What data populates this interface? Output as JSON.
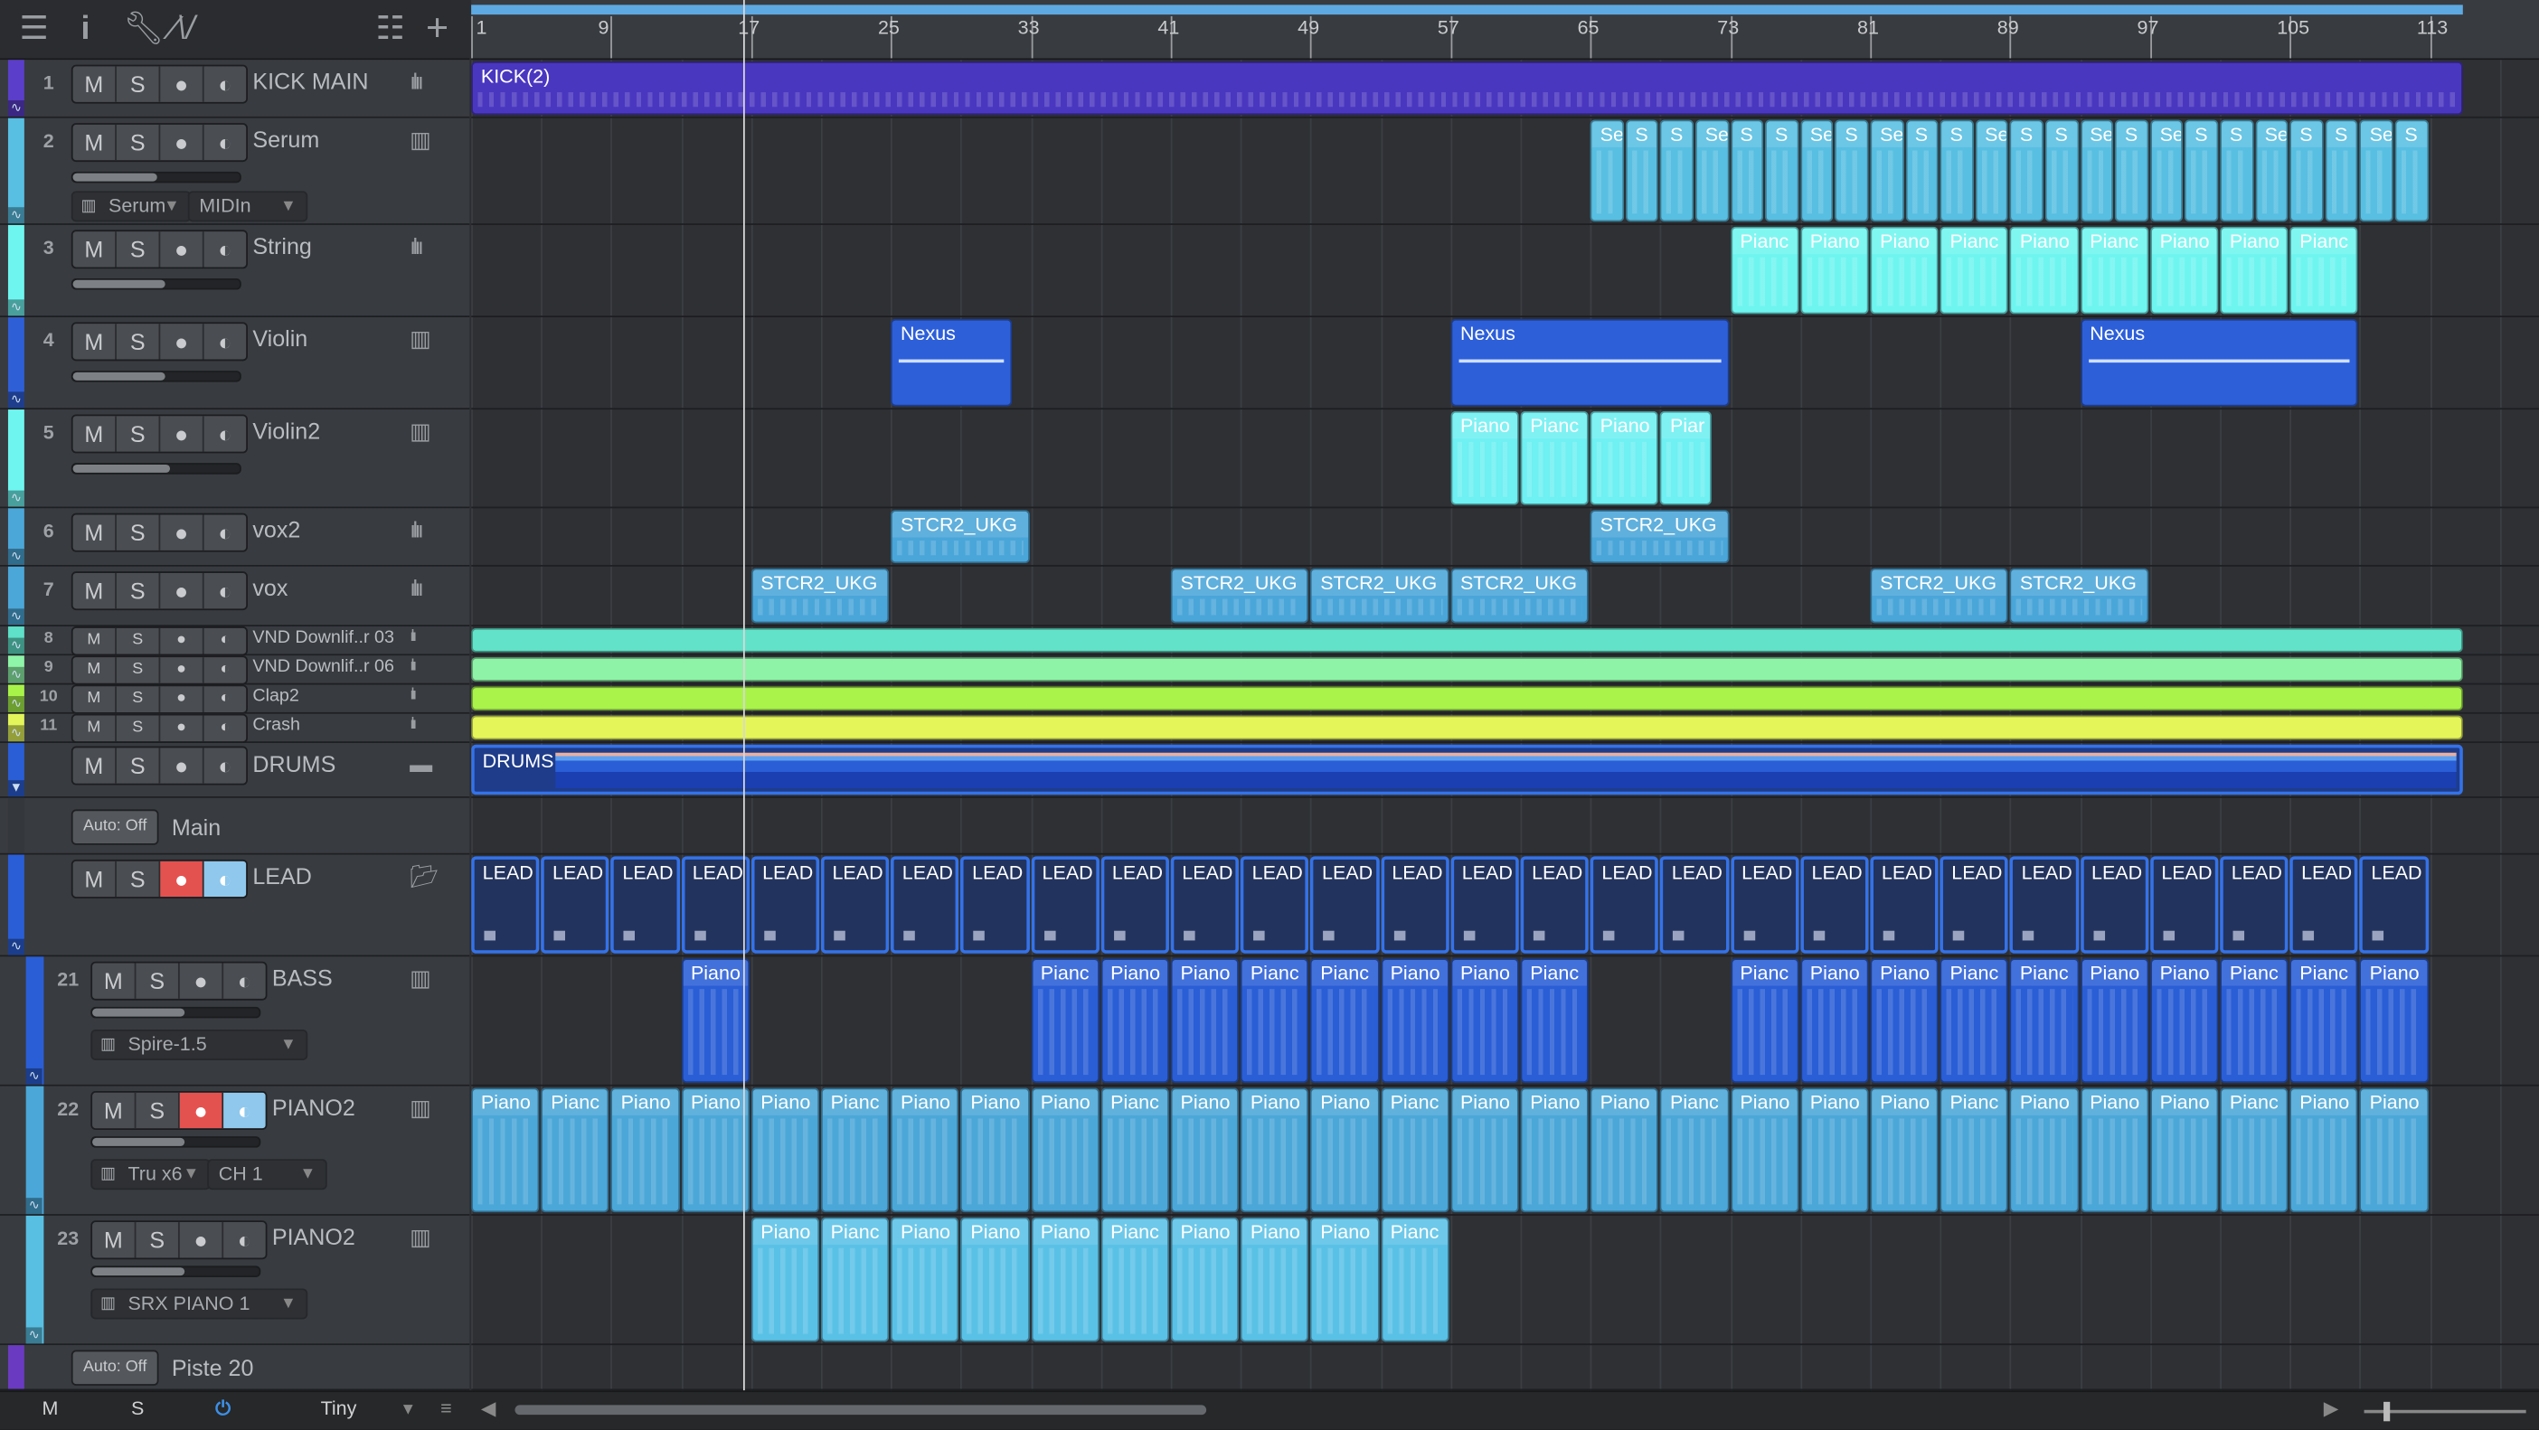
{
  "toolbar": {
    "icons": [
      "menu-icon",
      "info-icon",
      "wrench-icon",
      "automation-icon",
      "track-list-icon",
      "add-track-icon"
    ]
  },
  "ruler": {
    "bars": [
      "1",
      "9",
      "17",
      "25",
      "33",
      "41",
      "49",
      "57",
      "65",
      "73",
      "81",
      "89",
      "97",
      "105",
      "113"
    ]
  },
  "tracks": [
    {
      "num": "1",
      "name": "KICK MAIN",
      "color": "#5b3ec9",
      "type": "audio",
      "h": 36,
      "icon": "waveform",
      "clips": [
        {
          "s": 1,
          "l": 114,
          "t": "KICK(2)",
          "c": "#4a37c0"
        }
      ]
    },
    {
      "num": "2",
      "name": "Serum",
      "color": "#58bfe2",
      "type": "inst",
      "h": 66,
      "icon": "piano",
      "fader": 0.5,
      "sel": [
        "Serum",
        "MIDIn"
      ],
      "clips": "serum"
    },
    {
      "num": "3",
      "name": "String",
      "color": "#6ff5f0",
      "type": "audio2",
      "h": 57,
      "icon": "waveform",
      "fader": 0.55,
      "clips": "string"
    },
    {
      "num": "4",
      "name": "Violin",
      "color": "#2f5fd7",
      "type": "audio2",
      "h": 57,
      "icon": "piano",
      "fader": 0.55,
      "clips": [
        {
          "s": 25,
          "l": 7,
          "t": "Nexus",
          "c": "#2d5fd9"
        },
        {
          "s": 57,
          "l": 16,
          "t": "Nexus",
          "c": "#2d5fd9"
        },
        {
          "s": 93,
          "l": 16,
          "t": "Nexus",
          "c": "#2d5fd9"
        }
      ]
    },
    {
      "num": "5",
      "name": "Violin2",
      "color": "#6ff5f0",
      "type": "audio2",
      "h": 61,
      "icon": "piano",
      "fader": 0.58,
      "clips": [
        {
          "s": 57,
          "l": 4,
          "t": "Piano",
          "c": "#6ff0f2"
        },
        {
          "s": 61,
          "l": 4,
          "t": "Pianc",
          "c": "#6ff0f2"
        },
        {
          "s": 65,
          "l": 4,
          "t": "Piano",
          "c": "#6ff0f2"
        },
        {
          "s": 69,
          "l": 3,
          "t": "Piar",
          "c": "#6ff0f2"
        }
      ]
    },
    {
      "num": "6",
      "name": "vox2",
      "color": "#4ba7d8",
      "type": "audio",
      "h": 36,
      "icon": "waveform",
      "clips": [
        {
          "s": 25,
          "l": 8,
          "t": "STCR2_UKG",
          "c": "#4aa6d9"
        },
        {
          "s": 65,
          "l": 8,
          "t": "STCR2_UKG",
          "c": "#4aa6d9"
        }
      ]
    },
    {
      "num": "7",
      "name": "vox",
      "color": "#4ba7d8",
      "type": "audio",
      "h": 37,
      "icon": "waveform",
      "clips": [
        {
          "s": 17,
          "l": 8,
          "t": "STCR2_UKG",
          "c": "#4aa6d9"
        },
        {
          "s": 41,
          "l": 8,
          "t": "STCR2_UKG",
          "c": "#4aa6d9"
        },
        {
          "s": 49,
          "l": 8,
          "t": "STCR2_UKG",
          "c": "#4aa6d9"
        },
        {
          "s": 57,
          "l": 8,
          "t": "STCR2_UKG",
          "c": "#4aa6d9"
        },
        {
          "s": 81,
          "l": 8,
          "t": "STCR2_UKG",
          "c": "#4aa6d9"
        },
        {
          "s": 89,
          "l": 8,
          "t": "STCR2_UKG",
          "c": "#4aa6d9"
        }
      ]
    },
    {
      "num": "8",
      "name": "VND Downlif..r 03",
      "color": "#5fe0c8",
      "type": "small",
      "h": 18,
      "icon": "waveform",
      "clips": [
        {
          "s": 1,
          "l": 114,
          "t": "",
          "c": "#62e3c9"
        }
      ]
    },
    {
      "num": "9",
      "name": "VND Downlif..r 06",
      "color": "#8ff5a8",
      "type": "small",
      "h": 18,
      "icon": "waveform",
      "clips": [
        {
          "s": 1,
          "l": 114,
          "t": "",
          "c": "#8ef3a6"
        }
      ]
    },
    {
      "num": "10",
      "name": "Clap2",
      "color": "#a8f34a",
      "type": "small",
      "h": 18,
      "icon": "waveform",
      "clips": [
        {
          "s": 1,
          "l": 114,
          "t": "",
          "c": "#a9f34b"
        }
      ]
    },
    {
      "num": "11",
      "name": "Crash",
      "color": "#e3f55a",
      "type": "small",
      "h": 18,
      "icon": "waveform",
      "clips": [
        {
          "s": 1,
          "l": 114,
          "t": "",
          "c": "#e4f559"
        }
      ]
    },
    {
      "num": "",
      "name": "DRUMS",
      "color": "#2a5ed6",
      "type": "folder",
      "h": 34,
      "icon": "folder",
      "clips": [
        {
          "s": 1,
          "l": 114,
          "t": "DRUMS",
          "c": "#1f3c8a"
        }
      ]
    },
    {
      "num": "",
      "name": "Main",
      "color": "#34373c",
      "type": "auto",
      "h": 35,
      "auto": "Auto: Off",
      "clips": []
    },
    {
      "num": "",
      "name": "LEAD",
      "color": "#2a5ed6",
      "type": "folderlead",
      "h": 63,
      "icon": "folder-open",
      "clips": "lead"
    },
    {
      "num": "21",
      "name": "BASS",
      "color": "#2a5ed6",
      "type": "sub",
      "h": 80,
      "icon": "piano",
      "fader": 0.55,
      "sel": [
        "Spire-1.5"
      ],
      "clips": "bass"
    },
    {
      "num": "22",
      "name": "PIANO2",
      "color": "#4ba7d8",
      "type": "subrec",
      "h": 80,
      "icon": "piano",
      "fader": 0.55,
      "sel": [
        "Tru x6",
        "CH 1"
      ],
      "clips": "piano22"
    },
    {
      "num": "23",
      "name": "PIANO2",
      "color": "#58bfe2",
      "type": "sub",
      "h": 80,
      "icon": "piano",
      "fader": 0.55,
      "sel": [
        "SRX PIANO 1"
      ],
      "clips": "piano23"
    },
    {
      "num": "",
      "name": "Piste 20",
      "color": "#6a3bc0",
      "type": "auto",
      "h": 28,
      "auto": "Auto: Off",
      "clips": []
    }
  ],
  "buttons": {
    "mute": "M",
    "solo": "S",
    "record": "●",
    "monitor": "◐"
  },
  "bottom": {
    "mute_all": "M",
    "solo_all": "S",
    "size": "Tiny"
  }
}
